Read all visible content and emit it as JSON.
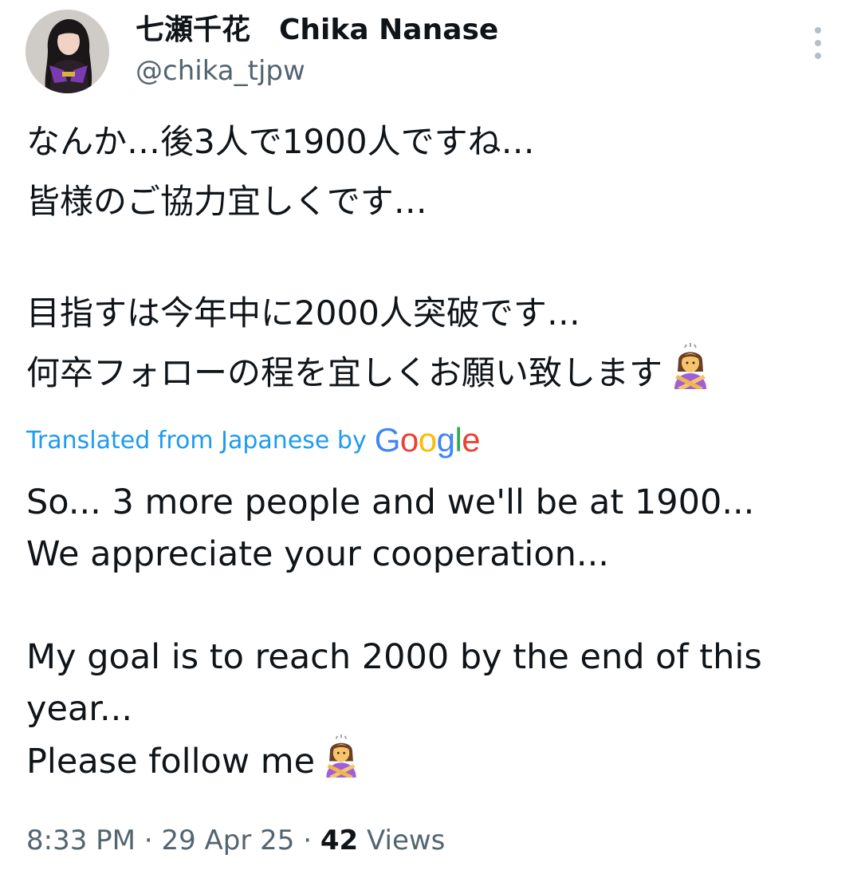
{
  "author": {
    "display_name": "七瀬千花　Chika Nanase",
    "handle": "@chika_tjpw"
  },
  "original_text": {
    "lines": [
      "なんか…後3人で1900人ですね…",
      "皆様のご協力宜しくです…",
      "目指すは今年中に2000人突破です…",
      "何卒フォローの程を宜しくお願い致します"
    ]
  },
  "translation_notice": {
    "label": "Translated from Japanese by",
    "provider": "Google"
  },
  "translated_text": {
    "lines": [
      "So... 3 more people and we'll be at 1900...",
      "We appreciate your cooperation...",
      "My goal is to reach 2000 by the end of this",
      "year...",
      "Please follow me"
    ]
  },
  "meta": {
    "time": "8:33 PM",
    "separator": " · ",
    "date": "29 Apr 25",
    "views_count": "42",
    "views_label": "Views"
  },
  "icons": {
    "more": "more-vertical-icon",
    "emoji": "person-gesturing-no-emoji"
  },
  "colors": {
    "link_blue": "#1d9bf0",
    "secondary_text": "#536471",
    "primary_text": "#0f1419"
  }
}
